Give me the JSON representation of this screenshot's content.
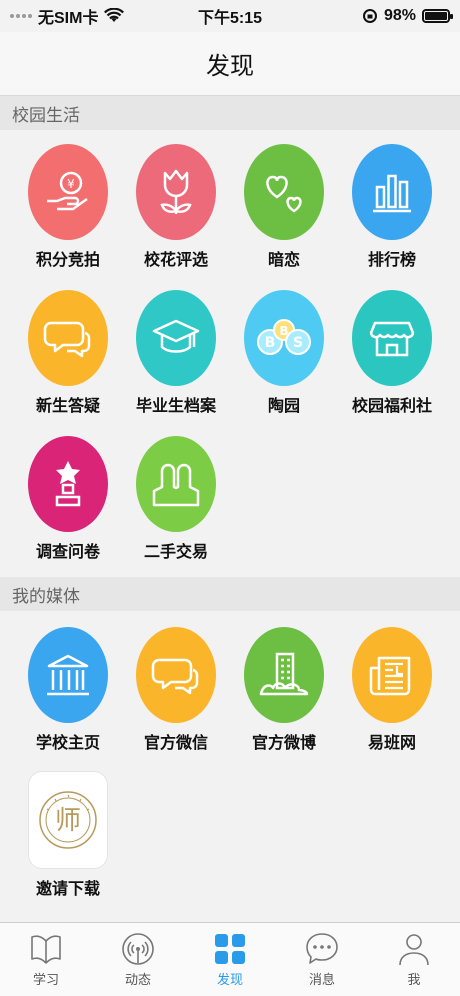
{
  "status": {
    "carrier": "无SIM卡",
    "time": "下午5:15",
    "battery": "98%",
    "battery_level": 0.98
  },
  "nav": {
    "title": "发现"
  },
  "sections": [
    {
      "title": "校园生活"
    },
    {
      "title": "我的媒体"
    }
  ],
  "campus": {
    "items": [
      {
        "label": "积分竞拍",
        "icon": "coin-hand-icon",
        "color": "#f36e6e"
      },
      {
        "label": "校花评选",
        "icon": "tulip-icon",
        "color": "#ec6a7a"
      },
      {
        "label": "暗恋",
        "icon": "hearts-icon",
        "color": "#6dbf44"
      },
      {
        "label": "排行榜",
        "icon": "bar-chart-icon",
        "color": "#3aa6ef"
      },
      {
        "label": "新生答疑",
        "icon": "chat-bubbles-icon",
        "color": "#fbb52a"
      },
      {
        "label": "毕业生档案",
        "icon": "graduation-cap-icon",
        "color": "#2fc8c6"
      },
      {
        "label": "陶园",
        "icon": "bbs-icon",
        "color": "#4fcaf2"
      },
      {
        "label": "校园福利社",
        "icon": "shop-icon",
        "color": "#2cc6c1"
      },
      {
        "label": "调查问卷",
        "icon": "trophy-icon",
        "color": "#d92478"
      },
      {
        "label": "二手交易",
        "icon": "people-icon",
        "color": "#7dcc46"
      }
    ]
  },
  "media": {
    "items": [
      {
        "label": "学校主页",
        "icon": "school-building-icon",
        "color": "#3aa6ef"
      },
      {
        "label": "官方微信",
        "icon": "wechat-bubbles-icon",
        "color": "#fbb52a"
      },
      {
        "label": "官方微博",
        "icon": "city-building-icon",
        "color": "#6dbf44"
      },
      {
        "label": "易班网",
        "icon": "newspaper-icon",
        "color": "#fbb52a"
      },
      {
        "label": "邀请下载",
        "icon": "college-logo-icon",
        "color": "#ffffff",
        "logo_char": "师"
      }
    ]
  },
  "tabs": [
    {
      "label": "学习",
      "icon": "book-icon",
      "active": false
    },
    {
      "label": "动态",
      "icon": "broadcast-icon",
      "active": false
    },
    {
      "label": "发现",
      "icon": "grid-icon",
      "active": true
    },
    {
      "label": "消息",
      "icon": "message-icon",
      "active": false
    },
    {
      "label": "我",
      "icon": "person-icon",
      "active": false
    }
  ],
  "colors": {
    "accent": "#2a9be8",
    "background": "#f2f2f2"
  }
}
